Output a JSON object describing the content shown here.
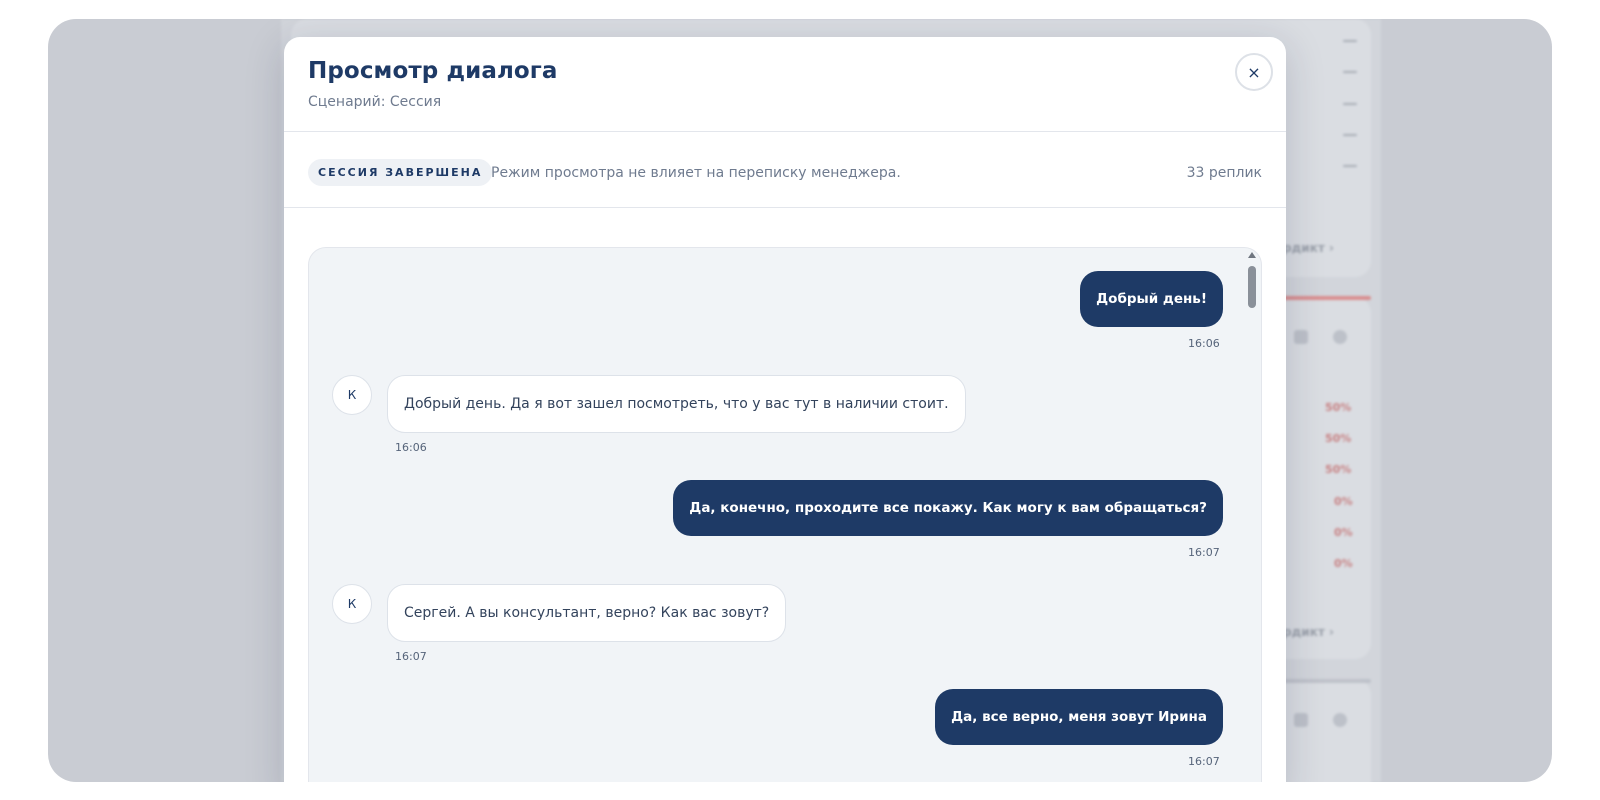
{
  "modal": {
    "title": "Просмотр диалога",
    "subtitle": "Сценарий: Сессия",
    "close_label": "×"
  },
  "status": {
    "badge": "СЕССИЯ ЗАВЕРШЕНА",
    "note": "Режим просмотра не влияет на переписку менеджера.",
    "count": "33 реплик"
  },
  "messages": [
    {
      "from": "manager",
      "text": "Добрый день!",
      "time": "16:06"
    },
    {
      "from": "client",
      "avatar": "К",
      "text": "Добрый день. Да я вот зашел посмотреть, что у вас тут в наличии стоит.",
      "time": "16:06"
    },
    {
      "from": "manager",
      "text": "Да, конечно, проходите все покажу. Как могу к вам обращаться?",
      "time": "16:07"
    },
    {
      "from": "client",
      "avatar": "К",
      "text": "Сергей. А вы консультант, верно? Как вас зовут?",
      "time": "16:07"
    },
    {
      "from": "manager",
      "text": "Да, все верно, меня зовут Ирина",
      "time": "16:07"
    }
  ],
  "background": {
    "percents": [
      "50%",
      "50%",
      "50%",
      "0%",
      "0%",
      "0%"
    ],
    "link_1": "рдикт ›",
    "link_2": "рдикт ›"
  },
  "colors": {
    "accent": "#1e3a66",
    "chat_bg": "#f1f4f7",
    "frame_bg": "#c9ccd3"
  }
}
